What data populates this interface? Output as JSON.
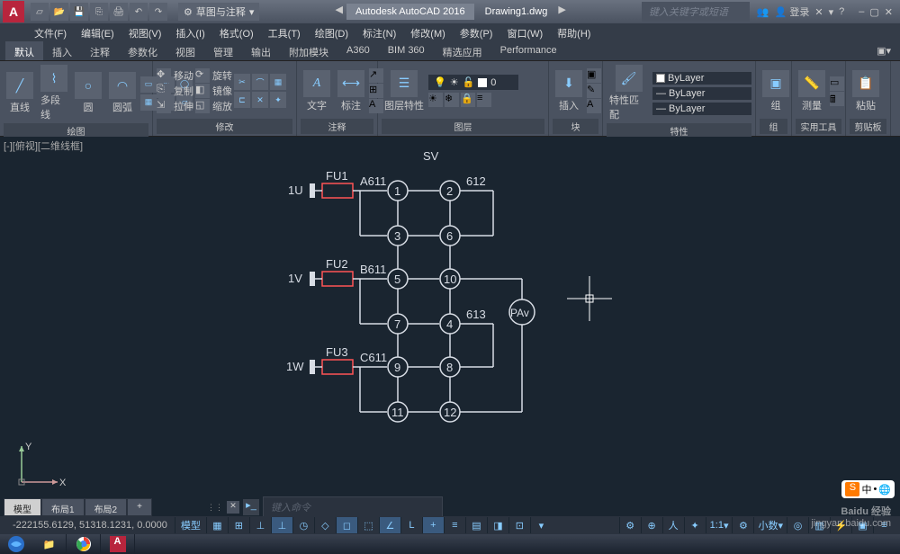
{
  "title": {
    "app": "Autodesk AutoCAD 2016",
    "doc": "Drawing1.dwg",
    "search_placeholder": "键入关键字或短语",
    "login": "登录",
    "workspace": "草图与注释"
  },
  "menu": [
    "文件(F)",
    "编辑(E)",
    "视图(V)",
    "插入(I)",
    "格式(O)",
    "工具(T)",
    "绘图(D)",
    "标注(N)",
    "修改(M)",
    "参数(P)",
    "窗口(W)",
    "帮助(H)"
  ],
  "ribbon_tabs": [
    "默认",
    "插入",
    "注释",
    "参数化",
    "视图",
    "管理",
    "输出",
    "附加模块",
    "A360",
    "BIM 360",
    "精选应用",
    "Performance"
  ],
  "panels": {
    "draw": {
      "title": "绘图",
      "items": [
        "直线",
        "多段线",
        "圆",
        "圆弧"
      ]
    },
    "modify": {
      "title": "修改",
      "items": {
        "move": "移动",
        "rotate": "旋转",
        "copy": "复制",
        "mirror": "镜像",
        "stretch": "拉伸",
        "scale": "缩放"
      }
    },
    "annot": {
      "title": "注释",
      "text": "文字",
      "dim": "标注"
    },
    "layer": {
      "title": "图层",
      "btn": "图层特性",
      "current": "0"
    },
    "block": {
      "title": "块",
      "insert": "插入"
    },
    "props": {
      "title": "特性",
      "match": "特性匹配",
      "layer": "ByLayer",
      "ltype": "ByLayer",
      "lweight": "ByLayer"
    },
    "group": {
      "title": "组",
      "btn": "组"
    },
    "util": {
      "title": "实用工具",
      "meas": "测量"
    },
    "clip": {
      "title": "剪贴板",
      "paste": "粘贴"
    }
  },
  "view_label": "[-][俯视][二维线框]",
  "drawing": {
    "title": "SV",
    "rows": [
      {
        "phase": "1U",
        "fuse": "FU1",
        "node": "A611",
        "t1": "1",
        "t2": "3",
        "r1": "2",
        "r2": "6",
        "rlabel": "612"
      },
      {
        "phase": "1V",
        "fuse": "FU2",
        "node": "B611",
        "t1": "5",
        "t2": "7",
        "r1": "10",
        "r2": "4",
        "rlabel": "613"
      },
      {
        "phase": "1W",
        "fuse": "FU3",
        "node": "C611",
        "t1": "9",
        "t2": "11",
        "r1": "8",
        "r2": "12",
        "rlabel": ""
      }
    ],
    "meter": "PAv"
  },
  "model_tabs": [
    "模型",
    "布局1",
    "布局2"
  ],
  "cmd_placeholder": "键入命令",
  "status": {
    "coords": "-222155.6129, 51318.1231, 0.0000",
    "model": "模型",
    "scale": "1:1",
    "decimal": "小数"
  },
  "watermark": {
    "brand": "Baidu 经验",
    "url": "jingyan.baidu.com"
  },
  "ime": {
    "s": "S",
    "zh": "中"
  }
}
